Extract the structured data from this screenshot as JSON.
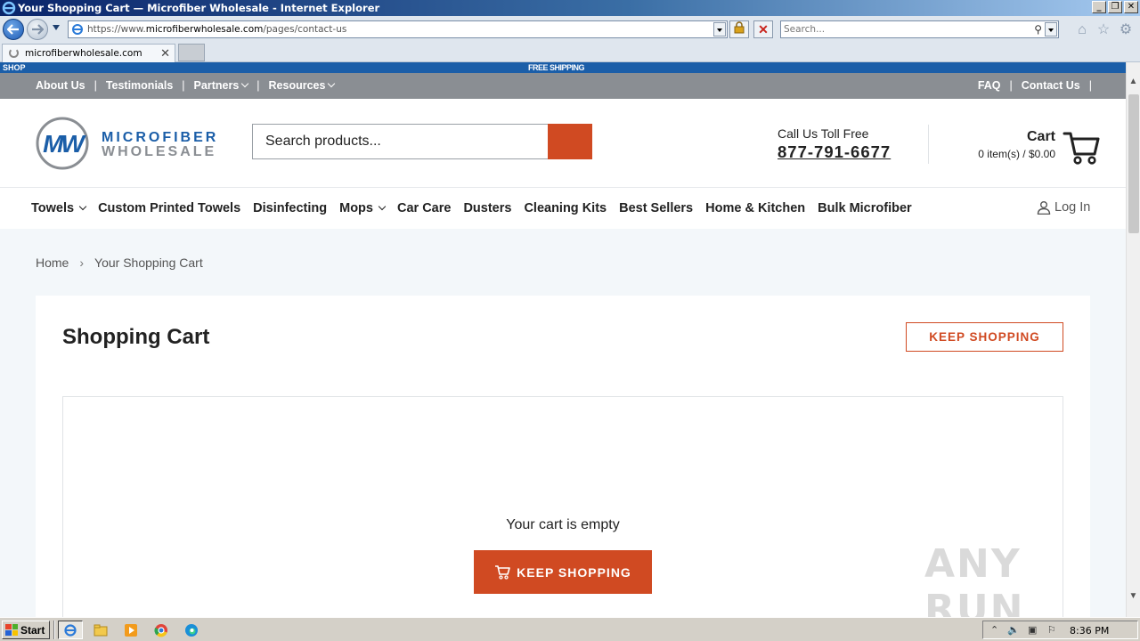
{
  "window": {
    "title": "Your Shopping Cart — Microfiber Wholesale - Internet Explorer",
    "controls": [
      "_",
      "❐",
      "✕"
    ]
  },
  "browser": {
    "url_prefix": "https://www.",
    "url_domain": "microfiberwholesale.com",
    "url_path": "/pages/contact-us",
    "search_placeholder": "Search...",
    "tab_label": "microfiberwholesale.com",
    "tab_close": "✕"
  },
  "site": {
    "announcement_left": "SHOP",
    "announcement_center": "FREE SHIPPING",
    "top_links": [
      {
        "label": "About Us"
      },
      {
        "label": "Testimonials"
      },
      {
        "label": "Partners"
      },
      {
        "label": "Resources"
      }
    ],
    "right_links": [
      {
        "label": "FAQ"
      },
      {
        "label": "Contact Us"
      }
    ],
    "separator": "|",
    "logo_line1": "MICROFIBER",
    "logo_line2": "WHOLESALE",
    "search_placeholder": "Search products...",
    "call_label": "Call Us Toll Free",
    "phone": "877-791-6677",
    "cart_title": "Cart",
    "cart_summary": "0 item(s) / $0.00",
    "nav": [
      {
        "label": "Towels",
        "dropdown": true
      },
      {
        "label": "Custom Printed Towels"
      },
      {
        "label": "Disinfecting"
      },
      {
        "label": "Mops",
        "dropdown": true
      },
      {
        "label": "Car Care"
      },
      {
        "label": "Dusters"
      },
      {
        "label": "Cleaning Kits"
      },
      {
        "label": "Best Sellers"
      },
      {
        "label": "Home & Kitchen"
      },
      {
        "label": "Bulk Microfiber"
      }
    ],
    "login_label": "Log In",
    "breadcrumb": {
      "home": "Home",
      "arrow": "›",
      "current": "Your Shopping Cart"
    },
    "page_title": "Shopping Cart",
    "keep_shopping_top": "KEEP SHOPPING",
    "empty_message": "Your cart is empty",
    "keep_shopping_main": "KEEP SHOPPING",
    "brand_color": "#1b5ea8",
    "accent_color": "#d04a22"
  },
  "watermark": "ANY RUN",
  "taskbar": {
    "start_label": "Start",
    "clock": "8:36 PM"
  }
}
